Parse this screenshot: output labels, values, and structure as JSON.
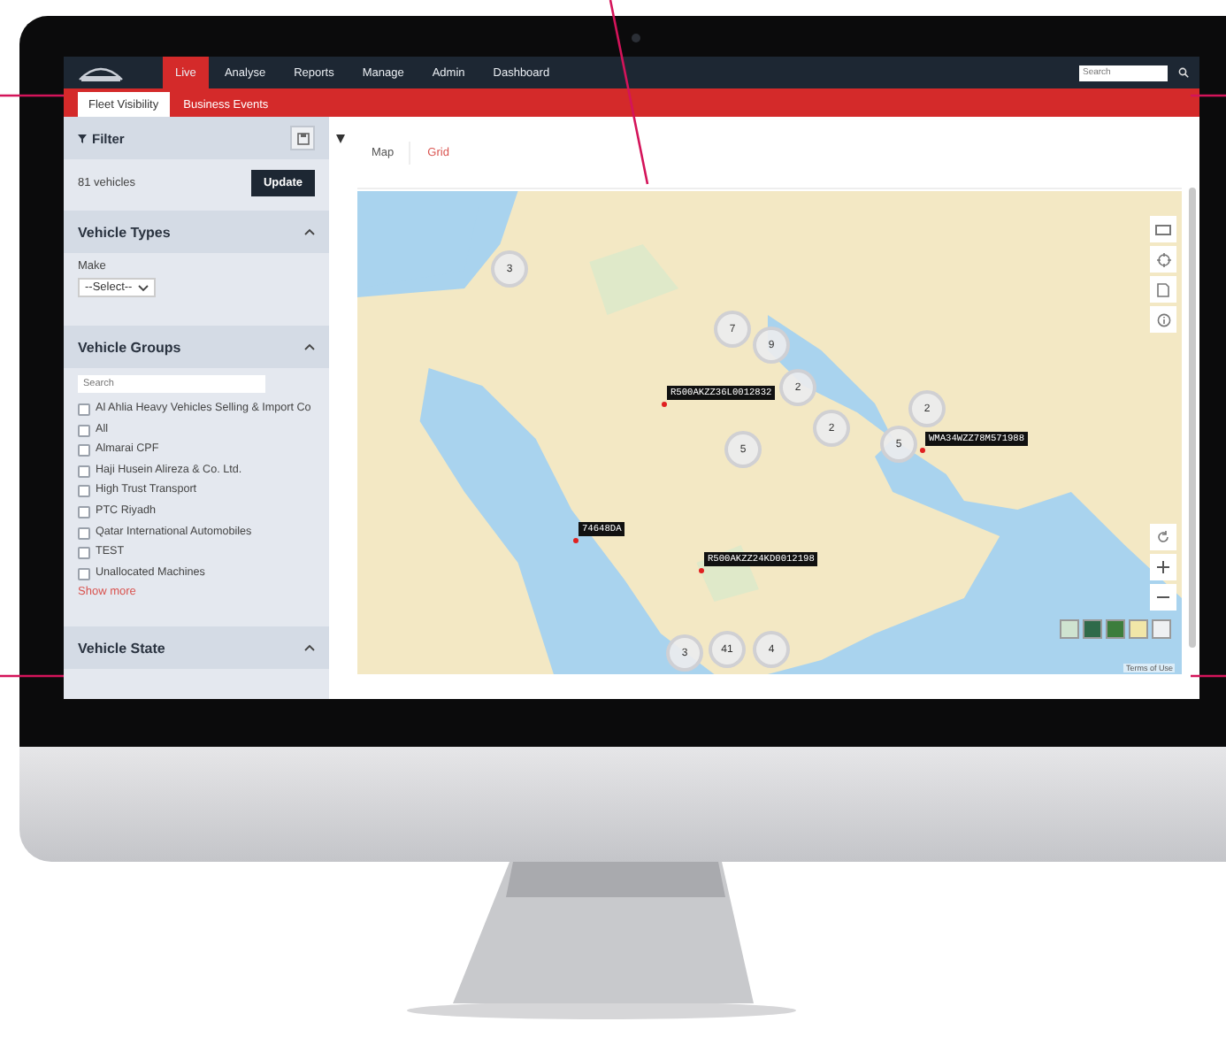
{
  "nav": {
    "items": [
      {
        "label": "Live",
        "selected": true
      },
      {
        "label": "Analyse",
        "selected": false
      },
      {
        "label": "Reports",
        "selected": false
      },
      {
        "label": "Manage",
        "selected": false
      },
      {
        "label": "Admin",
        "selected": false
      },
      {
        "label": "Dashboard",
        "selected": false
      }
    ],
    "search": {
      "placeholder": "Search"
    }
  },
  "subtabs": [
    {
      "label": "Fleet Visibility",
      "selected": true
    },
    {
      "label": "Business Events",
      "selected": false
    }
  ],
  "filter": {
    "title": "Filter",
    "count": "81 vehicles",
    "button": "Update"
  },
  "sections": [
    {
      "kind": "select",
      "title": "Vehicle Types",
      "expanded": true,
      "field_label": "Make",
      "value": "--Select--"
    },
    {
      "kind": "checklist",
      "title": "Vehicle Groups",
      "expanded": true,
      "search_placeholder": "Search",
      "more": "Show more",
      "items": [
        {
          "label": "Al Ahlia Heavy Vehicles Selling & Import Co",
          "checked": false
        },
        {
          "label": "All",
          "checked": false
        },
        {
          "label": "Almarai CPF",
          "checked": false
        },
        {
          "label": "Haji Husein Alireza & Co. Ltd.",
          "checked": false
        },
        {
          "label": "High Trust Transport",
          "checked": false
        },
        {
          "label": "PTC Riyadh",
          "checked": false
        },
        {
          "label": "Qatar International Automobiles",
          "checked": false
        },
        {
          "label": "TEST",
          "checked": false
        },
        {
          "label": "Unallocated Machines",
          "checked": false
        }
      ]
    },
    {
      "kind": "header",
      "title": "Vehicle State",
      "expanded": true
    }
  ],
  "view_tabs": [
    {
      "label": "Map",
      "selected": true
    },
    {
      "label": "Grid",
      "selected": false
    }
  ],
  "map": {
    "clusters": [
      "3",
      "7",
      "9",
      "2",
      "2",
      "5",
      "2",
      "5",
      "3",
      "41",
      "4"
    ],
    "vehicle_labels": [
      "R500AKZZ36L0012832",
      "WMA34WZZ78M571988",
      "74648DA",
      "R500AKZZ24KD0012198"
    ],
    "attribution": "Terms of Use"
  }
}
